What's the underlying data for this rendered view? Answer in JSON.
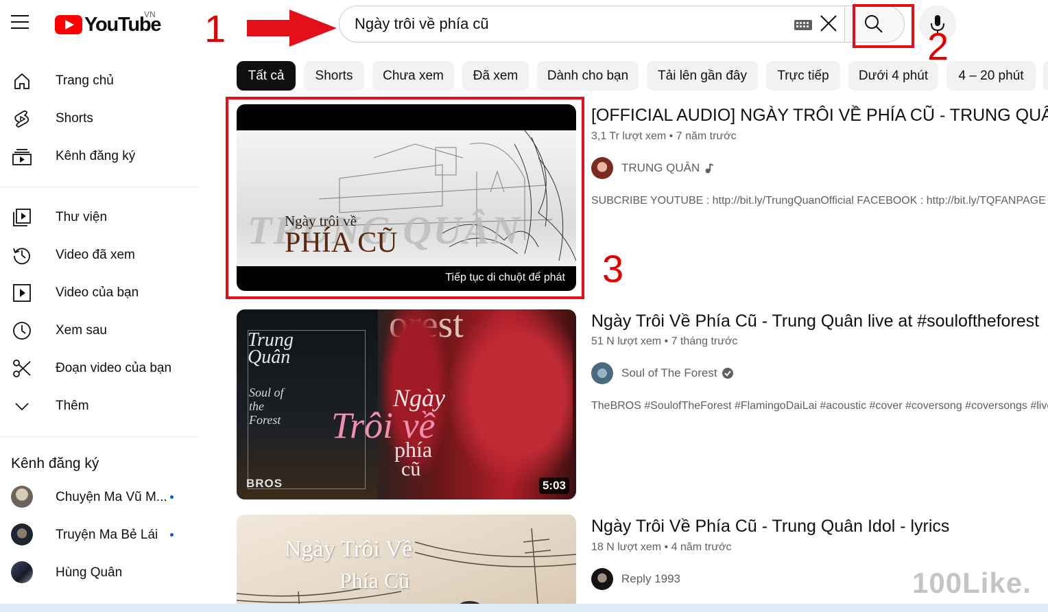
{
  "header": {
    "logo_text": "YouTube",
    "country": "VN",
    "search_value": "Ngày trôi về phía cũ"
  },
  "annotations": {
    "n1": "1",
    "n2": "2",
    "n3": "3"
  },
  "sidebar": {
    "main": [
      {
        "label": "Trang chủ",
        "icon": "home-icon"
      },
      {
        "label": "Shorts",
        "icon": "shorts-icon"
      },
      {
        "label": "Kênh đăng ký",
        "icon": "subscriptions-icon"
      }
    ],
    "library": [
      {
        "label": "Thư viện",
        "icon": "library-icon"
      },
      {
        "label": "Video đã xem",
        "icon": "history-icon"
      },
      {
        "label": "Video của bạn",
        "icon": "your-videos-icon"
      },
      {
        "label": "Xem sau",
        "icon": "watch-later-icon"
      },
      {
        "label": "Đoạn video của bạn",
        "icon": "clips-icon"
      },
      {
        "label": "Thêm",
        "icon": "chevron-down-icon"
      }
    ],
    "subs_heading": "Kênh đăng ký",
    "subs": [
      {
        "label": "Chuyện Ma Vũ M...",
        "new": true
      },
      {
        "label": "Truyện Ma Bẻ Lái",
        "new": true
      },
      {
        "label": "Hùng Quân",
        "new": false
      }
    ]
  },
  "chips": [
    "Tất cả",
    "Shorts",
    "Chưa xem",
    "Đã xem",
    "Dành cho bạn",
    "Tải lên gần đây",
    "Trực tiếp",
    "Dưới 4 phút",
    "4 – 20 phút"
  ],
  "videos": [
    {
      "title": "[OFFICIAL AUDIO] NGÀY TRÔI VỀ PHÍA CŨ - TRUNG QUÂN",
      "views": "3,1 Tr lượt xem",
      "age": "7 năm trước",
      "channel": "TRUNG QUÂN",
      "description": "SUBCRIBE YOUTUBE : http://bit.ly/TrungQuanOfficial FACEBOOK : http://bit.ly/TQFANPAGE SITE",
      "thumb_line1": "Ngày trôi về",
      "thumb_line2": "PHÍA CŨ",
      "thumb_bg_text": "TRUNG QUÂN",
      "hover_text": "Tiếp tục di chuột để phát"
    },
    {
      "title": "Ngày Trôi Về Phía Cũ - Trung Quân live at #souloftheforest",
      "views": "51 N lượt xem",
      "age": "7 tháng trước",
      "channel": "Soul of The Forest",
      "description": "TheBROS #SoulofTheForest #FlamingoDaiLai #acoustic #cover #coversong #coversongs #live",
      "duration": "5:03",
      "thumb_text1": "Trung Quân",
      "thumb_text2": "Soul of the Forest",
      "thumb_title_a": "Ngày",
      "thumb_title_b": "Trôi về",
      "thumb_title_c": "phía",
      "thumb_title_d": "cũ",
      "thumb_brand": "BROS",
      "thumb_forest": "orest"
    },
    {
      "title": "Ngày Trôi Về Phía Cũ - Trung Quân Idol - lyrics",
      "views": "18 N lượt xem",
      "age": "4 năm trước",
      "channel": "Reply 1993",
      "thumb_line1": "Ngày Trôi Về",
      "thumb_line2": "Phía Cũ"
    }
  ],
  "watermark": "100Like.",
  "colors": {
    "brand_red": "#ff0000",
    "annotation_red": "#e3101a",
    "link_blue": "#065fd4"
  }
}
